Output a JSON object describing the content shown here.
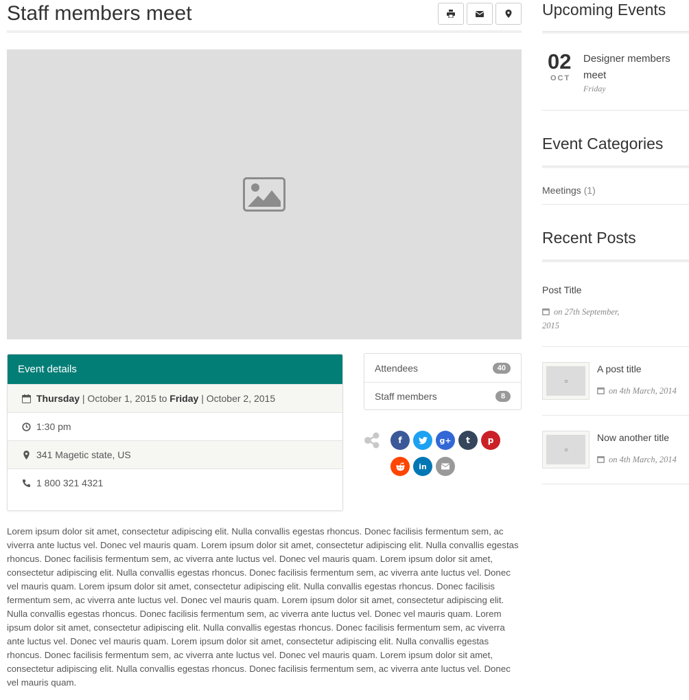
{
  "event": {
    "title": "Staff members meet",
    "details_heading": "Event details",
    "date": {
      "start_day": "Thursday",
      "start_date": "| October 1, 2015 to",
      "end_day": "Friday",
      "end_date": "| October 2, 2015"
    },
    "time": "1:30 pm",
    "location": "341 Magetic state, US",
    "phone": "1 800 321 4321",
    "attendees": [
      {
        "label": "Attendees",
        "count": "40"
      },
      {
        "label": "Staff members",
        "count": "8"
      }
    ],
    "description": "Lorem ipsum dolor sit amet, consectetur adipiscing elit. Nulla convallis egestas rhoncus. Donec facilisis fermentum sem, ac viverra ante luctus vel. Donec vel mauris quam. Lorem ipsum dolor sit amet, consectetur adipiscing elit. Nulla convallis egestas rhoncus. Donec facilisis fermentum sem, ac viverra ante luctus vel. Donec vel mauris quam. Lorem ipsum dolor sit amet, consectetur adipiscing elit. Nulla convallis egestas rhoncus. Donec facilisis fermentum sem, ac viverra ante luctus vel. Donec vel mauris quam. Lorem ipsum dolor sit amet, consectetur adipiscing elit. Nulla convallis egestas rhoncus. Donec facilisis fermentum sem, ac viverra ante luctus vel. Donec vel mauris quam. Lorem ipsum dolor sit amet, consectetur adipiscing elit. Nulla convallis egestas rhoncus. Donec facilisis fermentum sem, ac viverra ante luctus vel. Donec vel mauris quam. Lorem ipsum dolor sit amet, consectetur adipiscing elit. Nulla convallis egestas rhoncus. Donec facilisis fermentum sem, ac viverra ante luctus vel. Donec vel mauris quam. Lorem ipsum dolor sit amet, consectetur adipiscing elit. Nulla convallis egestas rhoncus. Donec facilisis fermentum sem, ac viverra ante luctus vel. Donec vel mauris quam. Lorem ipsum dolor sit amet, consectetur adipiscing elit. Nulla convallis egestas rhoncus. Donec facilisis fermentum sem, ac viverra ante luctus vel. Donec vel mauris quam."
  },
  "toolbar": {
    "icons": [
      "print-icon",
      "envelope-icon",
      "map-marker-icon"
    ]
  },
  "share": {
    "icons": [
      "facebook-icon",
      "twitter-icon",
      "google-plus-icon",
      "tumblr-icon",
      "pinterest-icon",
      "reddit-icon",
      "linkedin-icon",
      "email-icon"
    ],
    "colors": {
      "facebook": "#3b5998",
      "twitter": "#1da1f2",
      "google_plus": "#3367d6",
      "tumblr": "#35465c",
      "pinterest": "#cb2027",
      "reddit": "#ff4500",
      "linkedin": "#0077b5",
      "email": "#999999"
    }
  },
  "colors": {
    "accent": "#037e77",
    "hero_placeholder": "#dedede"
  },
  "sidebar": {
    "upcoming": {
      "title": "Upcoming Events",
      "items": [
        {
          "day": "02",
          "month": "OCT",
          "name": "Designer members meet",
          "weekday": "Friday"
        }
      ]
    },
    "categories": {
      "title": "Event Categories",
      "items": [
        {
          "label": "Meetings",
          "count": "(1)"
        }
      ]
    },
    "recent": {
      "title": "Recent Posts",
      "items": [
        {
          "title": "Post Title",
          "date": "on 27th September, 2015"
        },
        {
          "title": "A post title",
          "date": "on 4th March, 2014"
        },
        {
          "title": "Now another title",
          "date": "on 4th March, 2014"
        }
      ]
    }
  }
}
